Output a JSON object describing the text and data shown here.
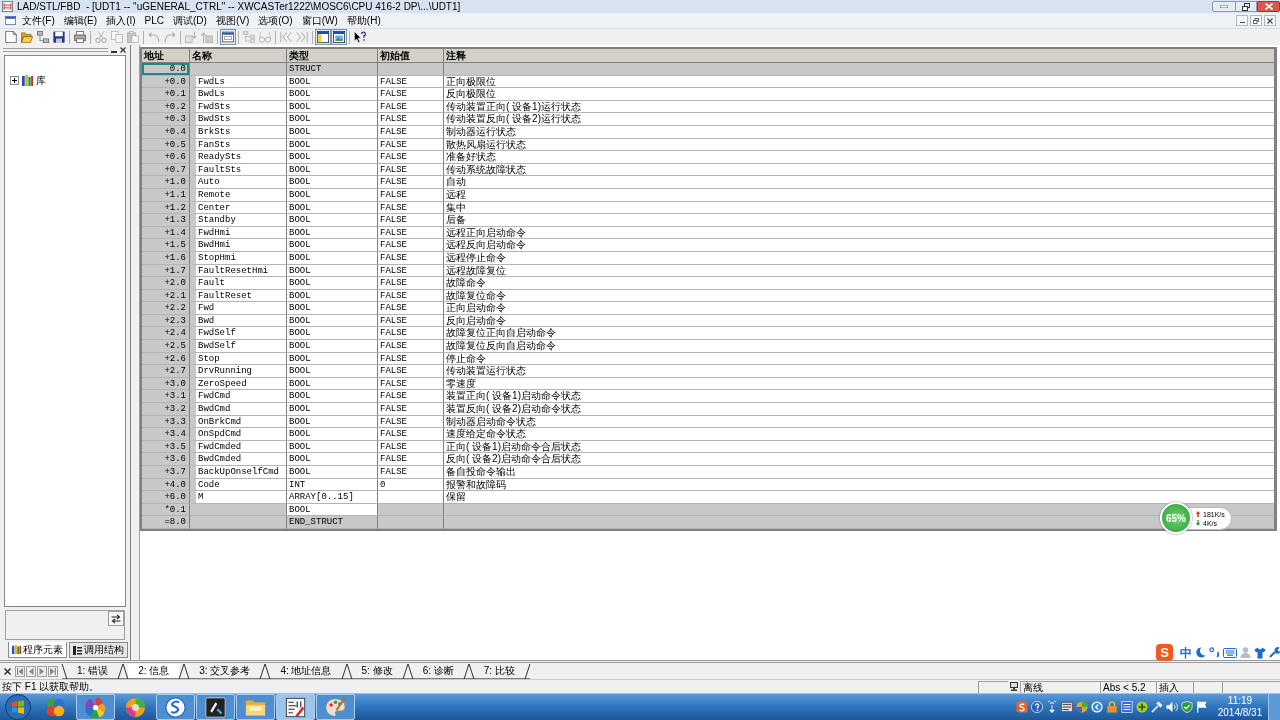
{
  "window": {
    "title": "LAD/STL/FBD  - [UDT1 -- \"uGENERAL_CTRL\" -- XWCASTer1222\\MOSC6\\CPU 416-2 DP\\...\\UDT1]"
  },
  "menu": [
    "文件(F)",
    "编辑(E)",
    "插入(I)",
    "PLC",
    "调试(D)",
    "视图(V)",
    "选项(O)",
    "窗口(W)",
    "帮助(H)"
  ],
  "toolbar": [
    {
      "kind": "new",
      "disabled": false,
      "pressed": false
    },
    {
      "kind": "open",
      "disabled": false,
      "pressed": false
    },
    {
      "kind": "nodes",
      "disabled": false,
      "pressed": false
    },
    {
      "kind": "save",
      "disabled": false,
      "pressed": false
    },
    {
      "kind": "separator"
    },
    {
      "kind": "print",
      "disabled": false,
      "pressed": false
    },
    {
      "kind": "separator"
    },
    {
      "kind": "cut",
      "disabled": true,
      "pressed": false
    },
    {
      "kind": "copy",
      "disabled": true,
      "pressed": false
    },
    {
      "kind": "paste",
      "disabled": true,
      "pressed": false
    },
    {
      "kind": "separator"
    },
    {
      "kind": "undo",
      "disabled": true,
      "pressed": false
    },
    {
      "kind": "redo",
      "disabled": true,
      "pressed": false
    },
    {
      "kind": "separator"
    },
    {
      "kind": "download",
      "disabled": true,
      "pressed": false
    },
    {
      "kind": "upload",
      "disabled": true,
      "pressed": false
    },
    {
      "kind": "separator"
    },
    {
      "kind": "monitor",
      "disabled": false,
      "pressed": true
    },
    {
      "kind": "separator"
    },
    {
      "kind": "overview",
      "disabled": true,
      "pressed": false
    },
    {
      "kind": "glasses",
      "disabled": true,
      "pressed": false
    },
    {
      "kind": "separator"
    },
    {
      "kind": "first",
      "disabled": true,
      "pressed": false
    },
    {
      "kind": "last",
      "disabled": true,
      "pressed": false
    },
    {
      "kind": "separator"
    },
    {
      "kind": "layout",
      "disabled": false,
      "pressed": true
    },
    {
      "kind": "picture",
      "disabled": false,
      "pressed": true
    },
    {
      "kind": "separator"
    },
    {
      "kind": "help",
      "disabled": false,
      "pressed": false
    }
  ],
  "sidebar": {
    "tree": [
      {
        "label": "库",
        "expanded": false
      }
    ],
    "tabs": [
      {
        "label": "程序元素",
        "selected": true
      },
      {
        "label": "调用结构",
        "selected": false
      }
    ]
  },
  "table": {
    "columns": [
      "地址",
      "名称",
      "类型",
      "初始值",
      "注释"
    ],
    "rows": [
      {
        "kind": "struct_start",
        "address": "0.0",
        "type": "STRUCT",
        "selected": true
      },
      {
        "kind": "member",
        "address": "+0.0",
        "name": "FwdLs",
        "type": "BOOL",
        "initial_value": "FALSE",
        "comment": "正向极限位",
        "selected": false
      },
      {
        "kind": "member",
        "address": "+0.1",
        "name": "BwdLs",
        "type": "BOOL",
        "initial_value": "FALSE",
        "comment": "反向极限位",
        "selected": false
      },
      {
        "kind": "member",
        "address": "+0.2",
        "name": "FwdSts",
        "type": "BOOL",
        "initial_value": "FALSE",
        "comment": "传动装置正向( 设备1)运行状态",
        "selected": false
      },
      {
        "kind": "member",
        "address": "+0.3",
        "name": "BwdSts",
        "type": "BOOL",
        "initial_value": "FALSE",
        "comment": "传动装置反向( 设备2)运行状态",
        "selected": false
      },
      {
        "kind": "member",
        "address": "+0.4",
        "name": "BrkSts",
        "type": "BOOL",
        "initial_value": "FALSE",
        "comment": "制动器运行状态",
        "selected": false
      },
      {
        "kind": "member",
        "address": "+0.5",
        "name": "FanSts",
        "type": "BOOL",
        "initial_value": "FALSE",
        "comment": "散热风扇运行状态",
        "selected": false
      },
      {
        "kind": "member",
        "address": "+0.6",
        "name": "ReadySts",
        "type": "BOOL",
        "initial_value": "FALSE",
        "comment": "准备好状态",
        "selected": false
      },
      {
        "kind": "member",
        "address": "+0.7",
        "name": "FaultSts",
        "type": "BOOL",
        "initial_value": "FALSE",
        "comment": "传动系统故障状态",
        "selected": false
      },
      {
        "kind": "member",
        "address": "+1.0",
        "name": "Auto",
        "type": "BOOL",
        "initial_value": "FALSE",
        "comment": "自动",
        "selected": false
      },
      {
        "kind": "member",
        "address": "+1.1",
        "name": "Remote",
        "type": "BOOL",
        "initial_value": "FALSE",
        "comment": "远程",
        "selected": false
      },
      {
        "kind": "member",
        "address": "+1.2",
        "name": "Center",
        "type": "BOOL",
        "initial_value": "FALSE",
        "comment": "集中",
        "selected": false
      },
      {
        "kind": "member",
        "address": "+1.3",
        "name": "Standby",
        "type": "BOOL",
        "initial_value": "FALSE",
        "comment": "后备",
        "selected": false
      },
      {
        "kind": "member",
        "address": "+1.4",
        "name": "FwdHmi",
        "type": "BOOL",
        "initial_value": "FALSE",
        "comment": "远程正向启动命令",
        "selected": false
      },
      {
        "kind": "member",
        "address": "+1.5",
        "name": "BwdHmi",
        "type": "BOOL",
        "initial_value": "FALSE",
        "comment": "远程反向启动命令",
        "selected": false
      },
      {
        "kind": "member",
        "address": "+1.6",
        "name": "StopHmi",
        "type": "BOOL",
        "initial_value": "FALSE",
        "comment": "远程停止命令",
        "selected": false
      },
      {
        "kind": "member",
        "address": "+1.7",
        "name": "FaultResetHmi",
        "type": "BOOL",
        "initial_value": "FALSE",
        "comment": "远程故障复位",
        "selected": false
      },
      {
        "kind": "member",
        "address": "+2.0",
        "name": "Fault",
        "type": "BOOL",
        "initial_value": "FALSE",
        "comment": "故障命令",
        "selected": false
      },
      {
        "kind": "member",
        "address": "+2.1",
        "name": "FaultReset",
        "type": "BOOL",
        "initial_value": "FALSE",
        "comment": "故障复位命令",
        "selected": false
      },
      {
        "kind": "member",
        "address": "+2.2",
        "name": "Fwd",
        "type": "BOOL",
        "initial_value": "FALSE",
        "comment": "正向启动命令",
        "selected": false
      },
      {
        "kind": "member",
        "address": "+2.3",
        "name": "Bwd",
        "type": "BOOL",
        "initial_value": "FALSE",
        "comment": "反向启动命令",
        "selected": false
      },
      {
        "kind": "member",
        "address": "+2.4",
        "name": "FwdSelf",
        "type": "BOOL",
        "initial_value": "FALSE",
        "comment": "故障复位正向自启动命令",
        "selected": false
      },
      {
        "kind": "member",
        "address": "+2.5",
        "name": "BwdSelf",
        "type": "BOOL",
        "initial_value": "FALSE",
        "comment": "故障复位反向自启动命令",
        "selected": false
      },
      {
        "kind": "member",
        "address": "+2.6",
        "name": "Stop",
        "type": "BOOL",
        "initial_value": "FALSE",
        "comment": "停止命令",
        "selected": false
      },
      {
        "kind": "member",
        "address": "+2.7",
        "name": "DrvRunning",
        "type": "BOOL",
        "initial_value": "FALSE",
        "comment": "传动装置运行状态",
        "selected": false
      },
      {
        "kind": "member",
        "address": "+3.0",
        "name": "ZeroSpeed",
        "type": "BOOL",
        "initial_value": "FALSE",
        "comment": "零速度",
        "selected": false
      },
      {
        "kind": "member",
        "address": "+3.1",
        "name": "FwdCmd",
        "type": "BOOL",
        "initial_value": "FALSE",
        "comment": "装置正向( 设备1)启动命令状态",
        "selected": false
      },
      {
        "kind": "member",
        "address": "+3.2",
        "name": "BwdCmd",
        "type": "BOOL",
        "initial_value": "FALSE",
        "comment": "装置反向( 设备2)启动命令状态",
        "selected": false
      },
      {
        "kind": "member",
        "address": "+3.3",
        "name": "OnBrkCmd",
        "type": "BOOL",
        "initial_value": "FALSE",
        "comment": "制动器启动命令状态",
        "selected": false
      },
      {
        "kind": "member",
        "address": "+3.4",
        "name": "OnSpdCmd",
        "type": "BOOL",
        "initial_value": "FALSE",
        "comment": "速度给定命令状态",
        "selected": false
      },
      {
        "kind": "member",
        "address": "+3.5",
        "name": "FwdCmded",
        "type": "BOOL",
        "initial_value": "FALSE",
        "comment": "正向( 设备1)启动命令合后状态",
        "selected": false
      },
      {
        "kind": "member",
        "address": "+3.6",
        "name": "BwdCmded",
        "type": "BOOL",
        "initial_value": "FALSE",
        "comment": "反向( 设备2)启动命令合后状态",
        "selected": false
      },
      {
        "kind": "member",
        "address": "+3.7",
        "name": "BackUpOnselfCmd",
        "type": "BOOL",
        "initial_value": "FALSE",
        "comment": "备自投命令输出",
        "selected": false
      },
      {
        "kind": "member",
        "address": "+4.0",
        "name": "Code",
        "type": "INT",
        "initial_value": "0",
        "comment": "报警和故障码",
        "selected": false
      },
      {
        "kind": "member",
        "address": "+6.0",
        "name": "M",
        "type": "ARRAY[0..15]",
        "comment": "保留",
        "selected": false
      },
      {
        "kind": "element",
        "address": "*0.1",
        "type": "BOOL",
        "selected": false
      },
      {
        "kind": "struct_end",
        "address": "=8.0",
        "type": "END_STRUCT",
        "selected": false
      }
    ]
  },
  "output_tabs": [
    {
      "label": "1: 错误",
      "selected": false
    },
    {
      "label": "2: 信息",
      "selected": true
    },
    {
      "label": "3: 交叉参考",
      "selected": false
    },
    {
      "label": "4: 地址信息",
      "selected": false
    },
    {
      "label": "5: 修改",
      "selected": false
    },
    {
      "label": "6: 诊断",
      "selected": false
    },
    {
      "label": "7: 比较",
      "selected": false
    }
  ],
  "status_bar": {
    "hint": "按下 F1 以获取帮助。",
    "cells": [
      "离线",
      "Abs < 5.2",
      "插入"
    ]
  },
  "network_widget": {
    "percent": "65%",
    "upload": "181K/s",
    "download": "4K/s"
  },
  "ime_bar": {
    "logo": "S",
    "mode": "中"
  },
  "taskbar": {
    "apps": [
      {
        "kind": "circles",
        "running": false,
        "selected": false
      },
      {
        "kind": "pinwheel",
        "running": true,
        "selected": false
      },
      {
        "kind": "ball",
        "running": false,
        "selected": false
      },
      {
        "kind": "browser",
        "running": true,
        "selected": false
      },
      {
        "kind": "tool",
        "running": true,
        "selected": false
      },
      {
        "kind": "folder",
        "running": true,
        "selected": false
      },
      {
        "kind": "diagram",
        "running": true,
        "selected": true
      },
      {
        "kind": "paint",
        "running": true,
        "selected": false
      }
    ],
    "clock": {
      "time": "11:19",
      "date": "2014/8/31"
    }
  }
}
